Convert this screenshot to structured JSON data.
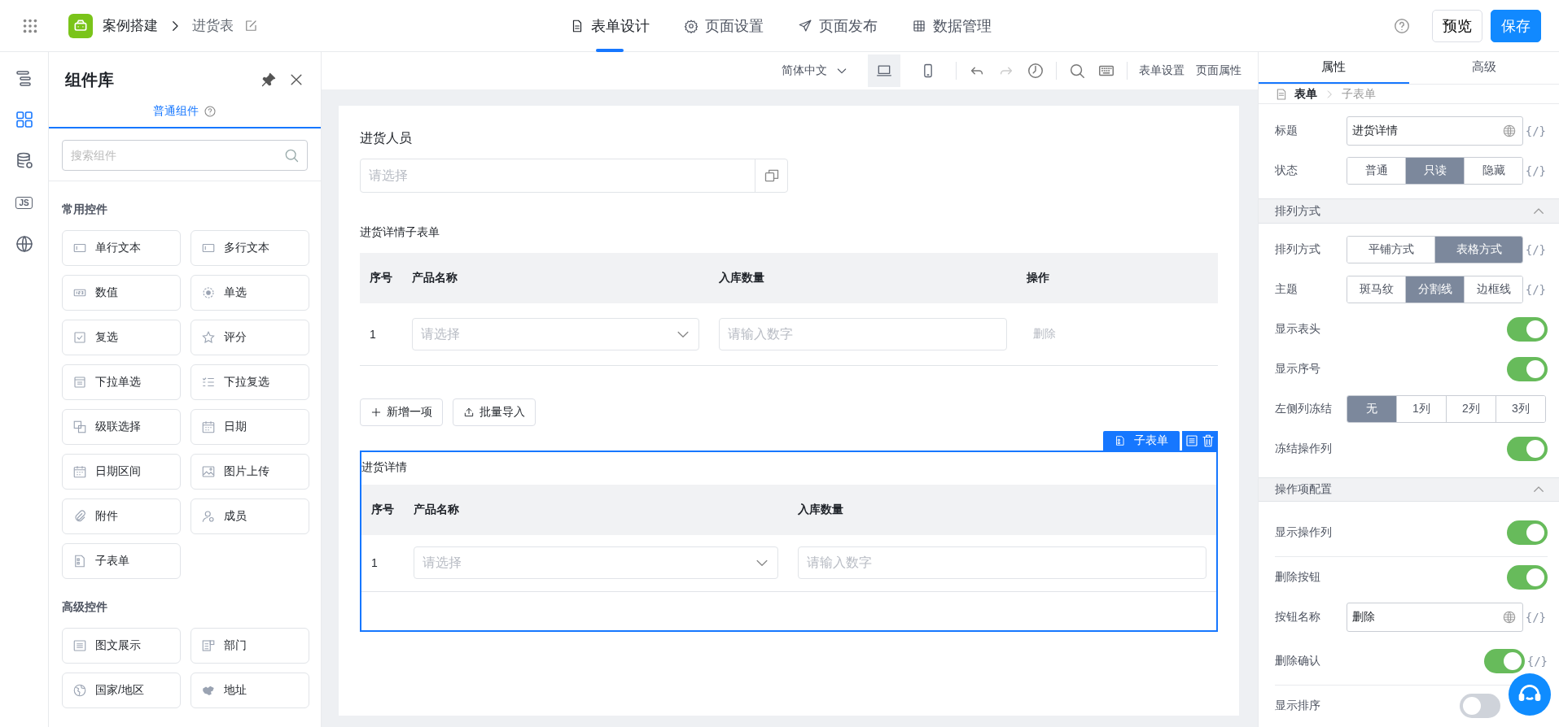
{
  "topbar": {
    "app_name": "案例搭建",
    "page_name": "进货表",
    "tabs": [
      {
        "kind": "form",
        "label": "表单设计",
        "selected": true
      },
      {
        "kind": "settings",
        "label": "页面设置",
        "selected": false
      },
      {
        "kind": "publish",
        "label": "页面发布",
        "selected": false
      },
      {
        "kind": "data",
        "label": "数据管理",
        "selected": false
      }
    ],
    "preview": "预览",
    "save": "保存"
  },
  "rail": [
    {
      "kind": "outline",
      "selected": false
    },
    {
      "kind": "components",
      "selected": true
    },
    {
      "kind": "database",
      "selected": false
    },
    {
      "kind": "js",
      "label": "JS",
      "selected": false
    },
    {
      "kind": "globe",
      "selected": false
    }
  ],
  "component_panel": {
    "title": "组件库",
    "tab": "普通组件",
    "search_placeholder": "搜索组件",
    "groups": [
      {
        "title": "常用控件",
        "items": [
          {
            "kind": "text",
            "label": "单行文本"
          },
          {
            "kind": "textarea",
            "label": "多行文本"
          },
          {
            "kind": "number",
            "label": "数值"
          },
          {
            "kind": "radio",
            "label": "单选"
          },
          {
            "kind": "checkbox",
            "label": "复选"
          },
          {
            "kind": "rating",
            "label": "评分"
          },
          {
            "kind": "select",
            "label": "下拉单选"
          },
          {
            "kind": "multiselect",
            "label": "下拉复选"
          },
          {
            "kind": "cascade",
            "label": "级联选择"
          },
          {
            "kind": "date",
            "label": "日期"
          },
          {
            "kind": "daterange",
            "label": "日期区间"
          },
          {
            "kind": "image",
            "label": "图片上传"
          },
          {
            "kind": "attachment",
            "label": "附件"
          },
          {
            "kind": "member",
            "label": "成员"
          },
          {
            "kind": "subform",
            "label": "子表单"
          }
        ]
      },
      {
        "title": "高级控件",
        "items": [
          {
            "kind": "richtext",
            "label": "图文展示"
          },
          {
            "kind": "department",
            "label": "部门"
          },
          {
            "kind": "country",
            "label": "国家/地区"
          },
          {
            "kind": "address",
            "label": "地址"
          }
        ]
      }
    ]
  },
  "toolbar": {
    "language": "简体中文",
    "devices": [
      {
        "kind": "desktop",
        "selected": true
      },
      {
        "kind": "mobile",
        "selected": false
      }
    ],
    "links": [
      "表单设置",
      "页面属性"
    ]
  },
  "form": {
    "person": {
      "label": "进货人员",
      "placeholder": "请选择"
    },
    "subform": {
      "label": "进货详情子表单",
      "columns": [
        "序号",
        "产品名称",
        "入库数量",
        "操作"
      ],
      "rows": [
        {
          "index": "1",
          "product_placeholder": "请选择",
          "quantity_placeholder": "请输入数字",
          "action": "删除"
        }
      ],
      "buttons": [
        {
          "kind": "add",
          "label": "新增一项"
        },
        {
          "kind": "import",
          "label": "批量导入"
        }
      ]
    },
    "selected_subform": {
      "badge": "子表单",
      "title": "进货详情",
      "columns": [
        "序号",
        "产品名称",
        "入库数量"
      ],
      "rows": [
        {
          "index": "1",
          "product_placeholder": "请选择",
          "quantity_placeholder": "请输入数字"
        }
      ]
    }
  },
  "properties": {
    "tabs": [
      {
        "label": "属性",
        "selected": true
      },
      {
        "label": "高级",
        "selected": false
      }
    ],
    "breadcrumb": [
      "表单",
      "子表单"
    ],
    "sections": [
      {
        "rows": [
          {
            "kind": "input",
            "label": "标题",
            "value": "进货详情",
            "expression": "{/}"
          },
          {
            "kind": "segmented",
            "label": "状态",
            "expression": "{/}",
            "options": [
              {
                "label": "普通",
                "selected": false
              },
              {
                "label": "只读",
                "selected": true
              },
              {
                "label": "隐藏",
                "selected": false
              }
            ]
          }
        ]
      },
      {
        "title": "排列方式",
        "expanded": true,
        "rows": [
          {
            "kind": "segmented",
            "label": "排列方式",
            "expression": "{/}",
            "options": [
              {
                "label": "平铺方式",
                "selected": false
              },
              {
                "label": "表格方式",
                "selected": true
              }
            ]
          },
          {
            "kind": "segmented",
            "label": "主题",
            "expression": "{/}",
            "options": [
              {
                "label": "斑马纹",
                "selected": false
              },
              {
                "label": "分割线",
                "selected": true
              },
              {
                "label": "边框线",
                "selected": false
              }
            ]
          },
          {
            "kind": "toggle",
            "label": "显示表头",
            "on": true
          },
          {
            "kind": "toggle",
            "label": "显示序号",
            "on": true
          },
          {
            "kind": "wide_segmented",
            "label": "左侧列冻结",
            "options": [
              {
                "label": "无",
                "selected": true
              },
              {
                "label": "1列",
                "selected": false
              },
              {
                "label": "2列",
                "selected": false
              },
              {
                "label": "3列",
                "selected": false
              }
            ]
          },
          {
            "kind": "toggle",
            "label": "冻结操作列",
            "on": true
          }
        ]
      },
      {
        "title": "操作项配置",
        "expanded": true,
        "rows": [
          {
            "kind": "toggle",
            "label": "显示操作列",
            "on": true,
            "divider": true
          },
          {
            "kind": "toggle",
            "label": "删除按钮",
            "on": true
          },
          {
            "kind": "input",
            "label": "按钮名称",
            "value": "删除",
            "expression": "{/}"
          },
          {
            "kind": "toggle",
            "label": "删除确认",
            "on": true,
            "expression": "{/}",
            "divider": true
          },
          {
            "kind": "toggle",
            "label": "显示排序",
            "on": false
          }
        ]
      }
    ]
  }
}
